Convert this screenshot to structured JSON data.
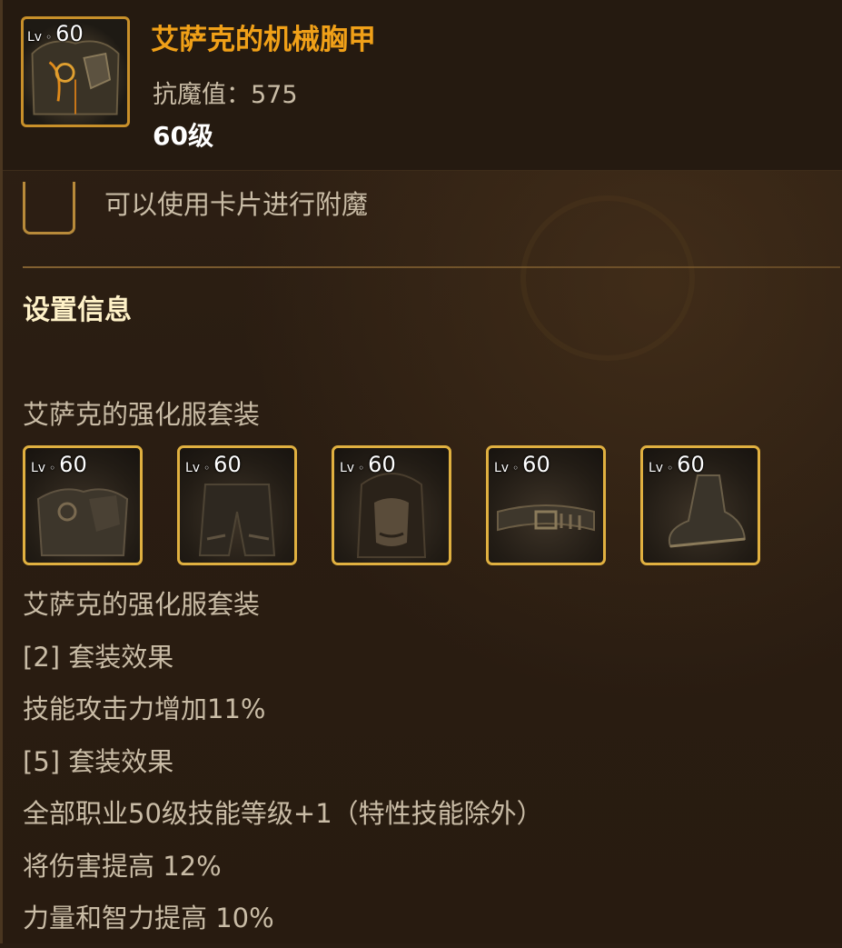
{
  "item": {
    "level_prefix": "Lv",
    "level_number": "60",
    "name": "艾萨克的机械胸甲",
    "resist_label": "抗魔值：",
    "resist_value": "575",
    "level_text": "60级",
    "icon_name": "mechanical-chestplate-icon"
  },
  "card": {
    "text": "可以使用卡片进行附魔"
  },
  "set_info": {
    "title": "设置信息",
    "set_name": "艾萨克的强化服套装",
    "pieces": [
      {
        "icon": "chest-armor-icon",
        "lv_prefix": "Lv",
        "lv": "60"
      },
      {
        "icon": "pants-armor-icon",
        "lv_prefix": "Lv",
        "lv": "60"
      },
      {
        "icon": "head-hair-icon",
        "lv_prefix": "Lv",
        "lv": "60"
      },
      {
        "icon": "belt-icon",
        "lv_prefix": "Lv",
        "lv": "60"
      },
      {
        "icon": "shoes-icon",
        "lv_prefix": "Lv",
        "lv": "60"
      }
    ],
    "effects": [
      "艾萨克的强化服套装",
      "[2] 套装效果",
      "技能攻击力增加11%",
      "[5] 套装效果",
      "全部职业50级技能等级+1（特性技能除外）",
      "将伤害提高 12%",
      "力量和智力提高 10%"
    ]
  },
  "colors": {
    "item_name": "#f0a018",
    "border_gold": "#e0b040",
    "text_gray": "#c9bca6"
  }
}
